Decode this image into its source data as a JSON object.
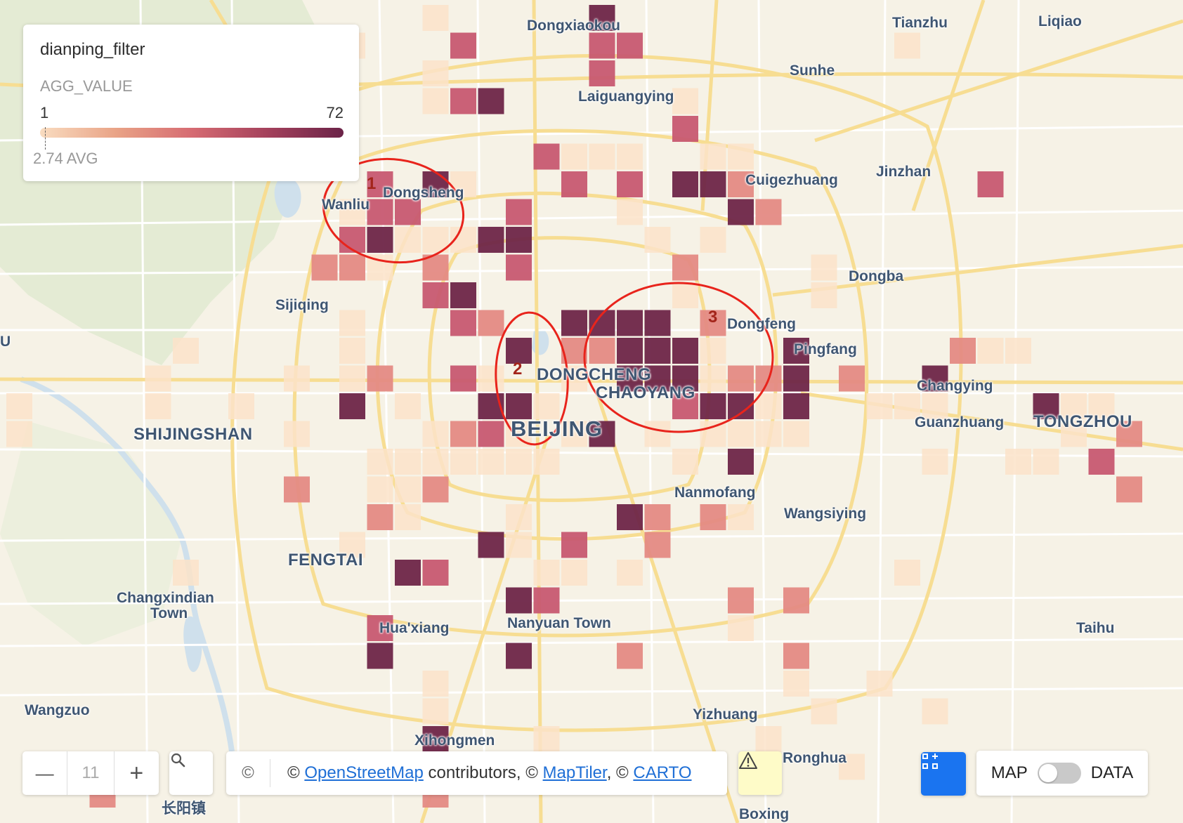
{
  "legend": {
    "title": "dianping_filter",
    "subtitle": "AGG_VALUE",
    "min": "1",
    "max": "72",
    "avg": "2.74 AVG"
  },
  "colors": {
    "v1": "#fbe3c9",
    "v2": "#e48a84",
    "v3": "#c75871",
    "v4": "#9a3c5d",
    "v5": "#6e2548",
    "annotation": "#e8241c"
  },
  "annotations": [
    "1",
    "2",
    "3"
  ],
  "places": [
    {
      "name": "Dongxiaokou",
      "size": "sm"
    },
    {
      "name": "Tianzhu",
      "size": "sm"
    },
    {
      "name": "Liqiao",
      "size": "sm"
    },
    {
      "name": "Sunhe",
      "size": "sm"
    },
    {
      "name": "Laiguangying",
      "size": "sm"
    },
    {
      "name": "Jinzhan",
      "size": "sm"
    },
    {
      "name": "Cuigezhuang",
      "size": "sm"
    },
    {
      "name": "Wanliu",
      "size": "sm"
    },
    {
      "name": "Dongsheng",
      "size": "sm"
    },
    {
      "name": "Dongba",
      "size": "sm"
    },
    {
      "name": "Sijiqing",
      "size": "sm"
    },
    {
      "name": "Dongfeng",
      "size": "sm"
    },
    {
      "name": "Pingfang",
      "size": "sm"
    },
    {
      "name": "DONGCHENG",
      "size": "lg"
    },
    {
      "name": "CHAOYANG",
      "size": "lg"
    },
    {
      "name": "Changying",
      "size": "sm"
    },
    {
      "name": "Guanzhuang",
      "size": "sm"
    },
    {
      "name": "TONGZHOU",
      "size": "lg"
    },
    {
      "name": "SHIJINGSHAN",
      "size": "lg"
    },
    {
      "name": "BEIJING",
      "size": "xl"
    },
    {
      "name": "Nanmofang",
      "size": "sm"
    },
    {
      "name": "Wangsiying",
      "size": "sm"
    },
    {
      "name": "FENGTAI",
      "size": "lg"
    },
    {
      "name": "Changxindian",
      "size": "sm"
    },
    {
      "name": "Town",
      "size": "sm"
    },
    {
      "name": "Hua'xiang",
      "size": "sm"
    },
    {
      "name": "Nanyuan Town",
      "size": "sm"
    },
    {
      "name": "Taihu",
      "size": "sm"
    },
    {
      "name": "Wangzuo",
      "size": "sm"
    },
    {
      "name": "Yizhuang",
      "size": "sm"
    },
    {
      "name": "Xihongmen",
      "size": "sm"
    },
    {
      "name": "Ronghua",
      "size": "sm"
    },
    {
      "name": "长阳镇",
      "size": "sm"
    },
    {
      "name": "Boxing",
      "size": "sm"
    },
    {
      "name": "U",
      "size": "sm"
    }
  ],
  "controls": {
    "zoom_out": "—",
    "zoom_level": "11",
    "zoom_in": "+",
    "attribution_icon": "©",
    "attr_prefix": "© ",
    "attr_osm": "OpenStreetMap",
    "attr_mid": " contributors, © ",
    "attr_maptiler": "MapTiler",
    "attr_sep": ", © ",
    "attr_carto": "CARTO",
    "view_map": "MAP",
    "view_data": "DATA",
    "icons": {
      "zoom_out": "minus-icon",
      "zoom_in": "plus-icon",
      "search": "search-icon",
      "warning": "warning-icon",
      "layers": "widgets-icon"
    }
  }
}
